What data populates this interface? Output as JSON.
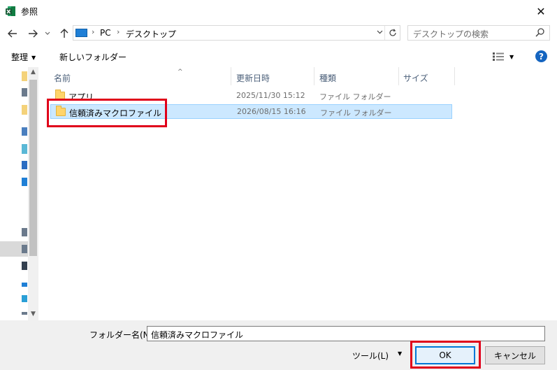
{
  "window": {
    "title": "参照",
    "close_glyph": "✕"
  },
  "address": {
    "crumbs": [
      "PC",
      "デスクトップ"
    ],
    "search_placeholder": "デスクトップの検索"
  },
  "toolbar": {
    "organize_label": "整理",
    "new_folder_label": "新しいフォルダー"
  },
  "columns": {
    "name": "名前",
    "modified": "更新日時",
    "type": "種類",
    "size": "サイズ"
  },
  "files": [
    {
      "name": "アプリ",
      "modified": "2025/11/30 15:12",
      "type": "ファイル フォルダー",
      "selected": false
    },
    {
      "name": "信頼済みマクロファイル",
      "modified": "2026/08/15 16:16",
      "type": "ファイル フォルダー",
      "selected": true
    }
  ],
  "bottom": {
    "folder_name_label": "フォルダー名(N):",
    "folder_name_value": "信頼済みマクロファイル",
    "tools_label": "ツール(L)",
    "ok_label": "OK",
    "cancel_label": "キャンセル"
  },
  "colors": {
    "selection_bg": "#cce8ff",
    "highlight_red": "#e0001a",
    "accent_blue": "#0078d7"
  }
}
